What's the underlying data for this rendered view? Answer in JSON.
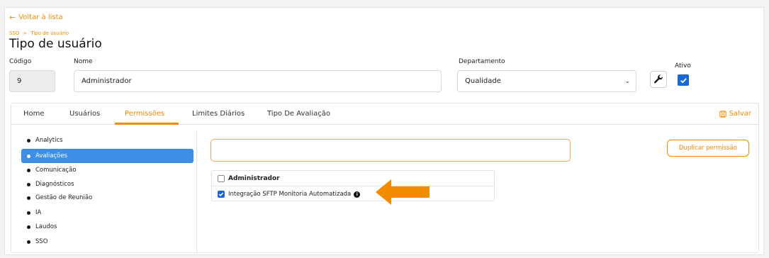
{
  "nav": {
    "back_label": "Voltar à lista",
    "back_icon": "arrow-left-icon"
  },
  "breadcrumb": {
    "root": "SSO",
    "separator": ">",
    "current": "Tipo de usuário"
  },
  "page_title": "Tipo de usuário",
  "form": {
    "codigo_label": "Código",
    "codigo_value": "9",
    "nome_label": "Nome",
    "nome_value": "Administrador",
    "departamento_label": "Departamento",
    "departamento_value": "Qualidade",
    "ativo_label": "Ativo",
    "ativo_checked": true
  },
  "tabs": [
    {
      "label": "Home"
    },
    {
      "label": "Usuários"
    },
    {
      "label": "Permissões",
      "active": true
    },
    {
      "label": "Limites Diários"
    },
    {
      "label": "Tipo De Avaliação"
    }
  ],
  "save_label": "Salvar",
  "sidebar": {
    "items": [
      {
        "label": "Analytics"
      },
      {
        "label": "Avaliações",
        "active": true
      },
      {
        "label": "Comunicação"
      },
      {
        "label": "Diagnósticos"
      },
      {
        "label": "Gestão de Reunião"
      },
      {
        "label": "IA"
      },
      {
        "label": "Laudos"
      },
      {
        "label": "SSO"
      }
    ]
  },
  "permissions": {
    "search_value": "",
    "duplicate_label": "Duplicar permissão",
    "group_label": "Administrador",
    "group_checked": false,
    "items": [
      {
        "label": "Integração SFTP Monitoria Automatizada",
        "checked": true,
        "info_icon": "info-icon"
      }
    ]
  },
  "colors": {
    "accent": "#f28b00",
    "active_blue": "#3c8ee6",
    "checkbox_blue": "#1a66d4"
  }
}
